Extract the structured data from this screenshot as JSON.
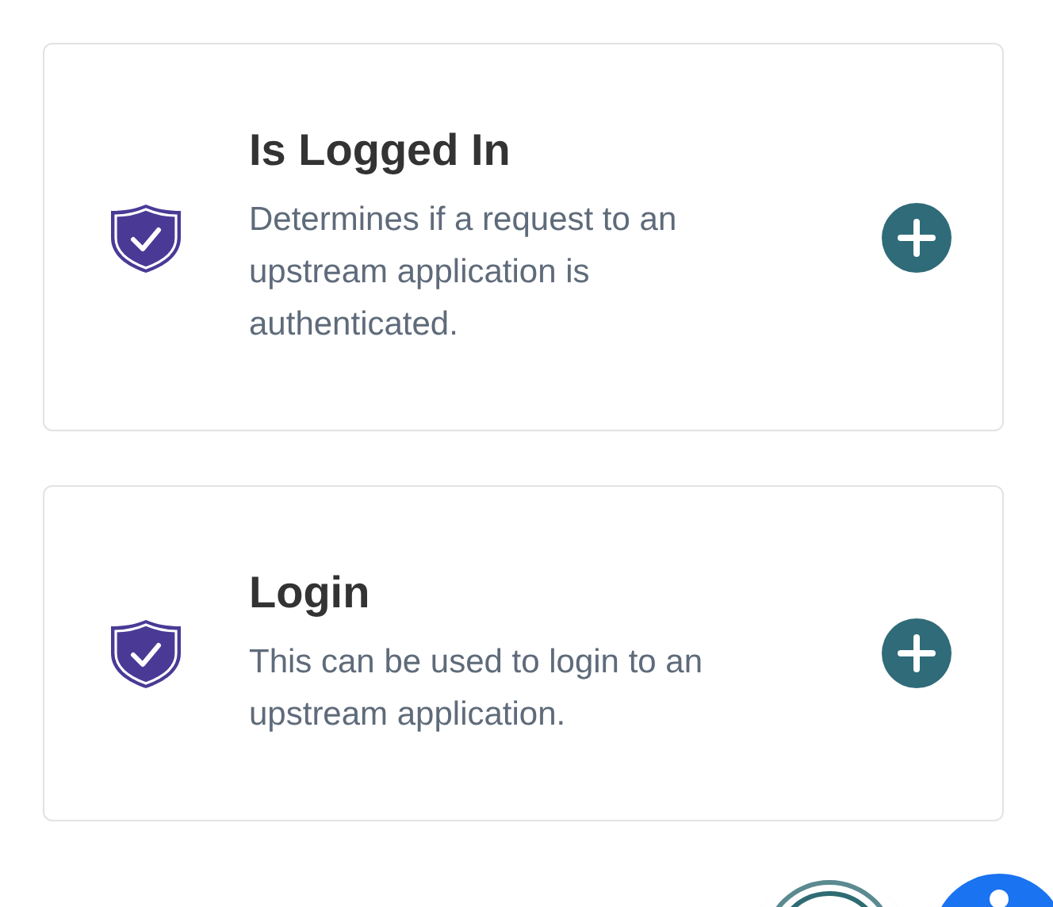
{
  "cards": [
    {
      "title": "Is Logged In",
      "description": "Determines if a request to an upstream application is authenticated."
    },
    {
      "title": "Login",
      "description": "This can be used to login to an upstream application."
    }
  ]
}
